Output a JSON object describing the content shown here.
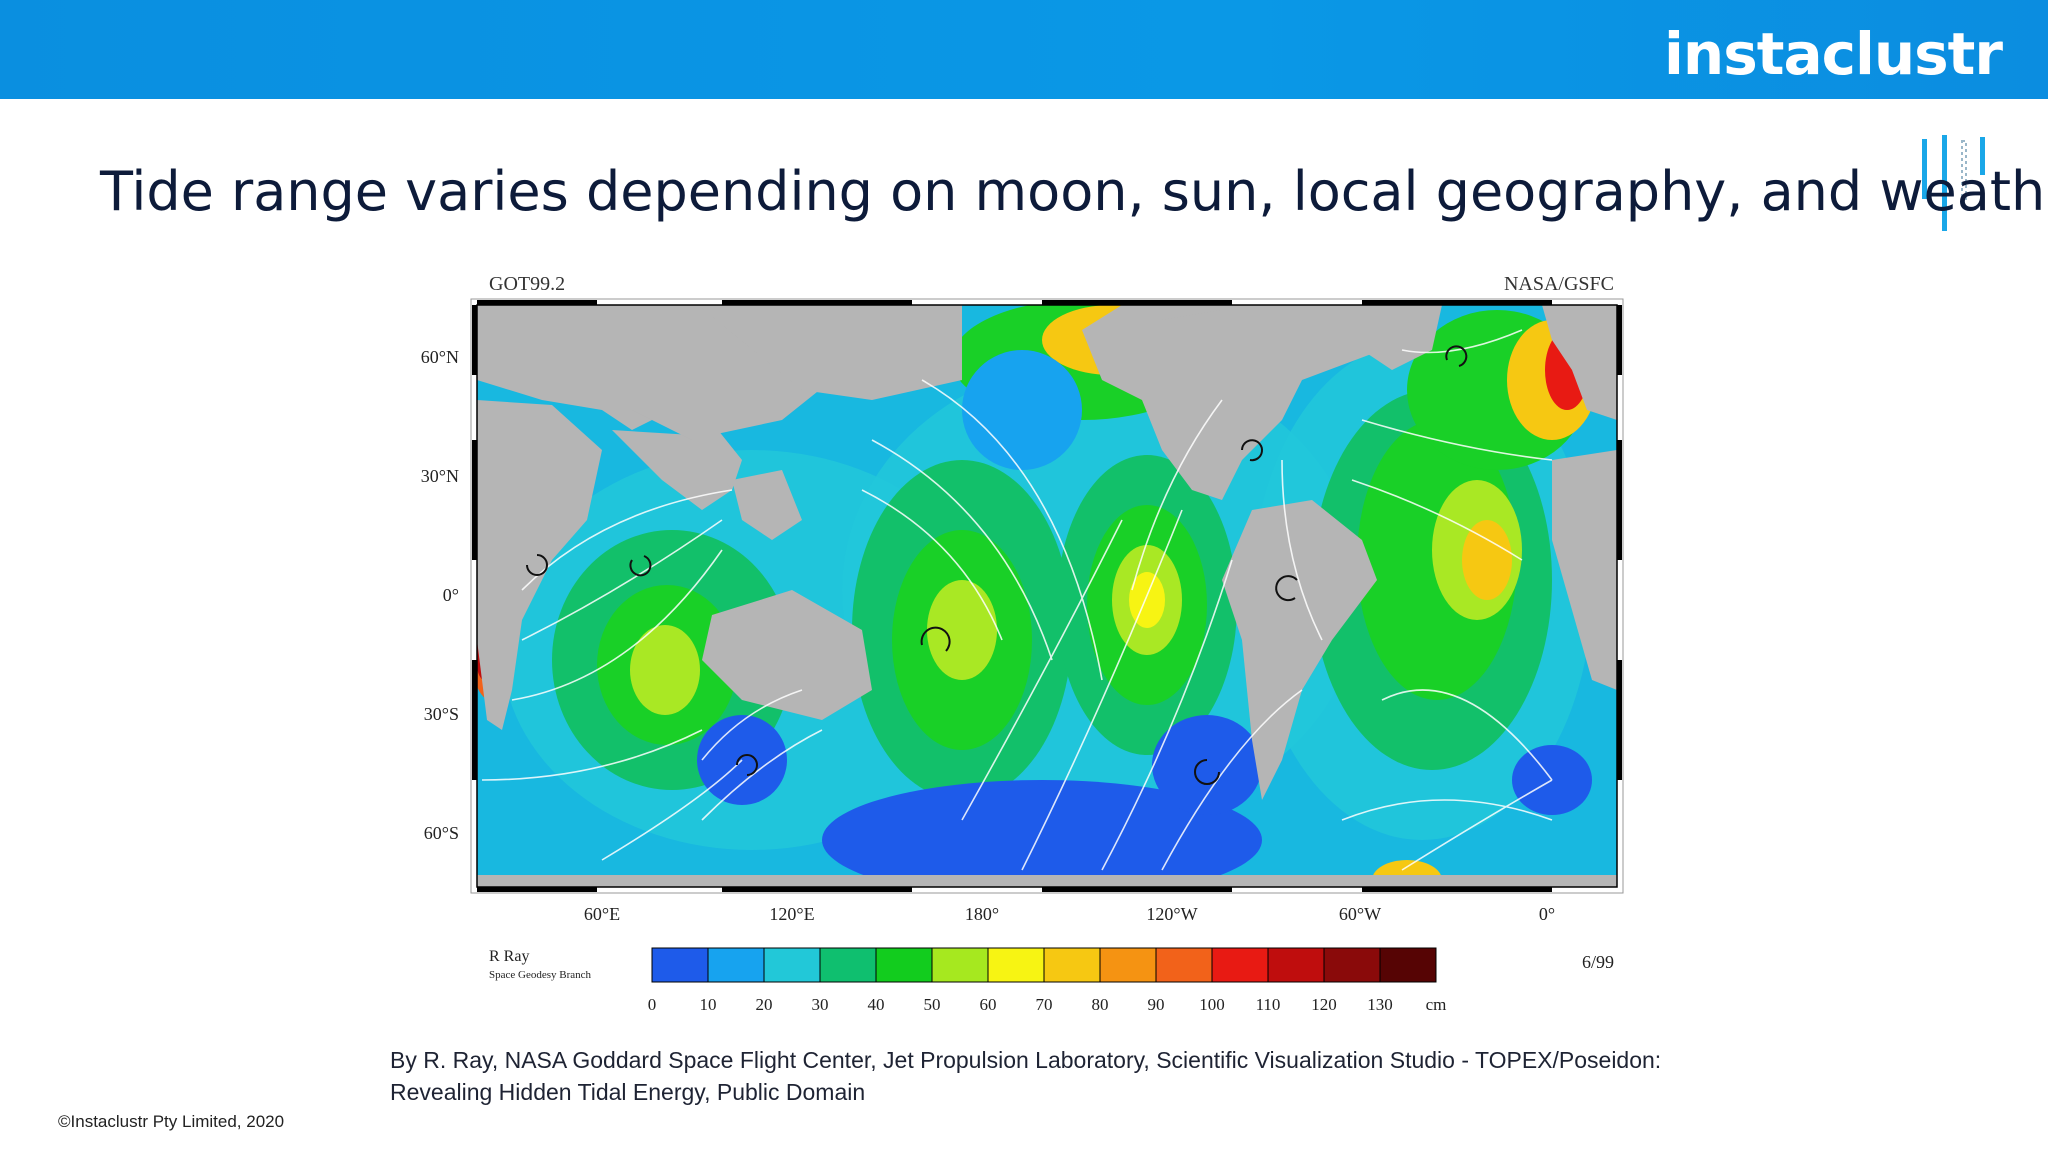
{
  "header": {
    "logo_text": "instaclustr",
    "bar_color": "#0a93e3"
  },
  "slide": {
    "title": "Tide range varies depending on moon, sun, local geography, and weather!"
  },
  "map": {
    "label_left": "GOT99.2",
    "label_right": "NASA/GSFC",
    "lat_labels": [
      "60°N",
      "30°N",
      "0°",
      "30°S",
      "60°S"
    ],
    "lon_labels": [
      "60°E",
      "120°E",
      "180°",
      "120°W",
      "60°W",
      "0°"
    ],
    "credit_name": "R Ray",
    "credit_dept": "Space Geodesy Branch",
    "date": "6/99",
    "colorbar_ticks": [
      "0",
      "10",
      "20",
      "30",
      "40",
      "50",
      "60",
      "70",
      "80",
      "90",
      "100",
      "110",
      "120",
      "130",
      "cm"
    ],
    "colorbar_colors": [
      "#1e5bea",
      "#17a3ef",
      "#22c8d8",
      "#0fbf6f",
      "#12cc1e",
      "#a6e81f",
      "#f7f413",
      "#f6c812",
      "#f59312",
      "#f2621a",
      "#e81a13",
      "#bf0d0d",
      "#8a0a0a",
      "#560404"
    ]
  },
  "caption": {
    "line1": "By R. Ray, NASA Goddard Space Flight Center, Jet Propulsion Laboratory, Scientific Visualization Studio - TOPEX/Poseidon:",
    "line2": "Revealing Hidden Tidal Energy, Public Domain"
  },
  "footer": {
    "copyright": "©Instaclustr Pty Limited, 2020"
  }
}
